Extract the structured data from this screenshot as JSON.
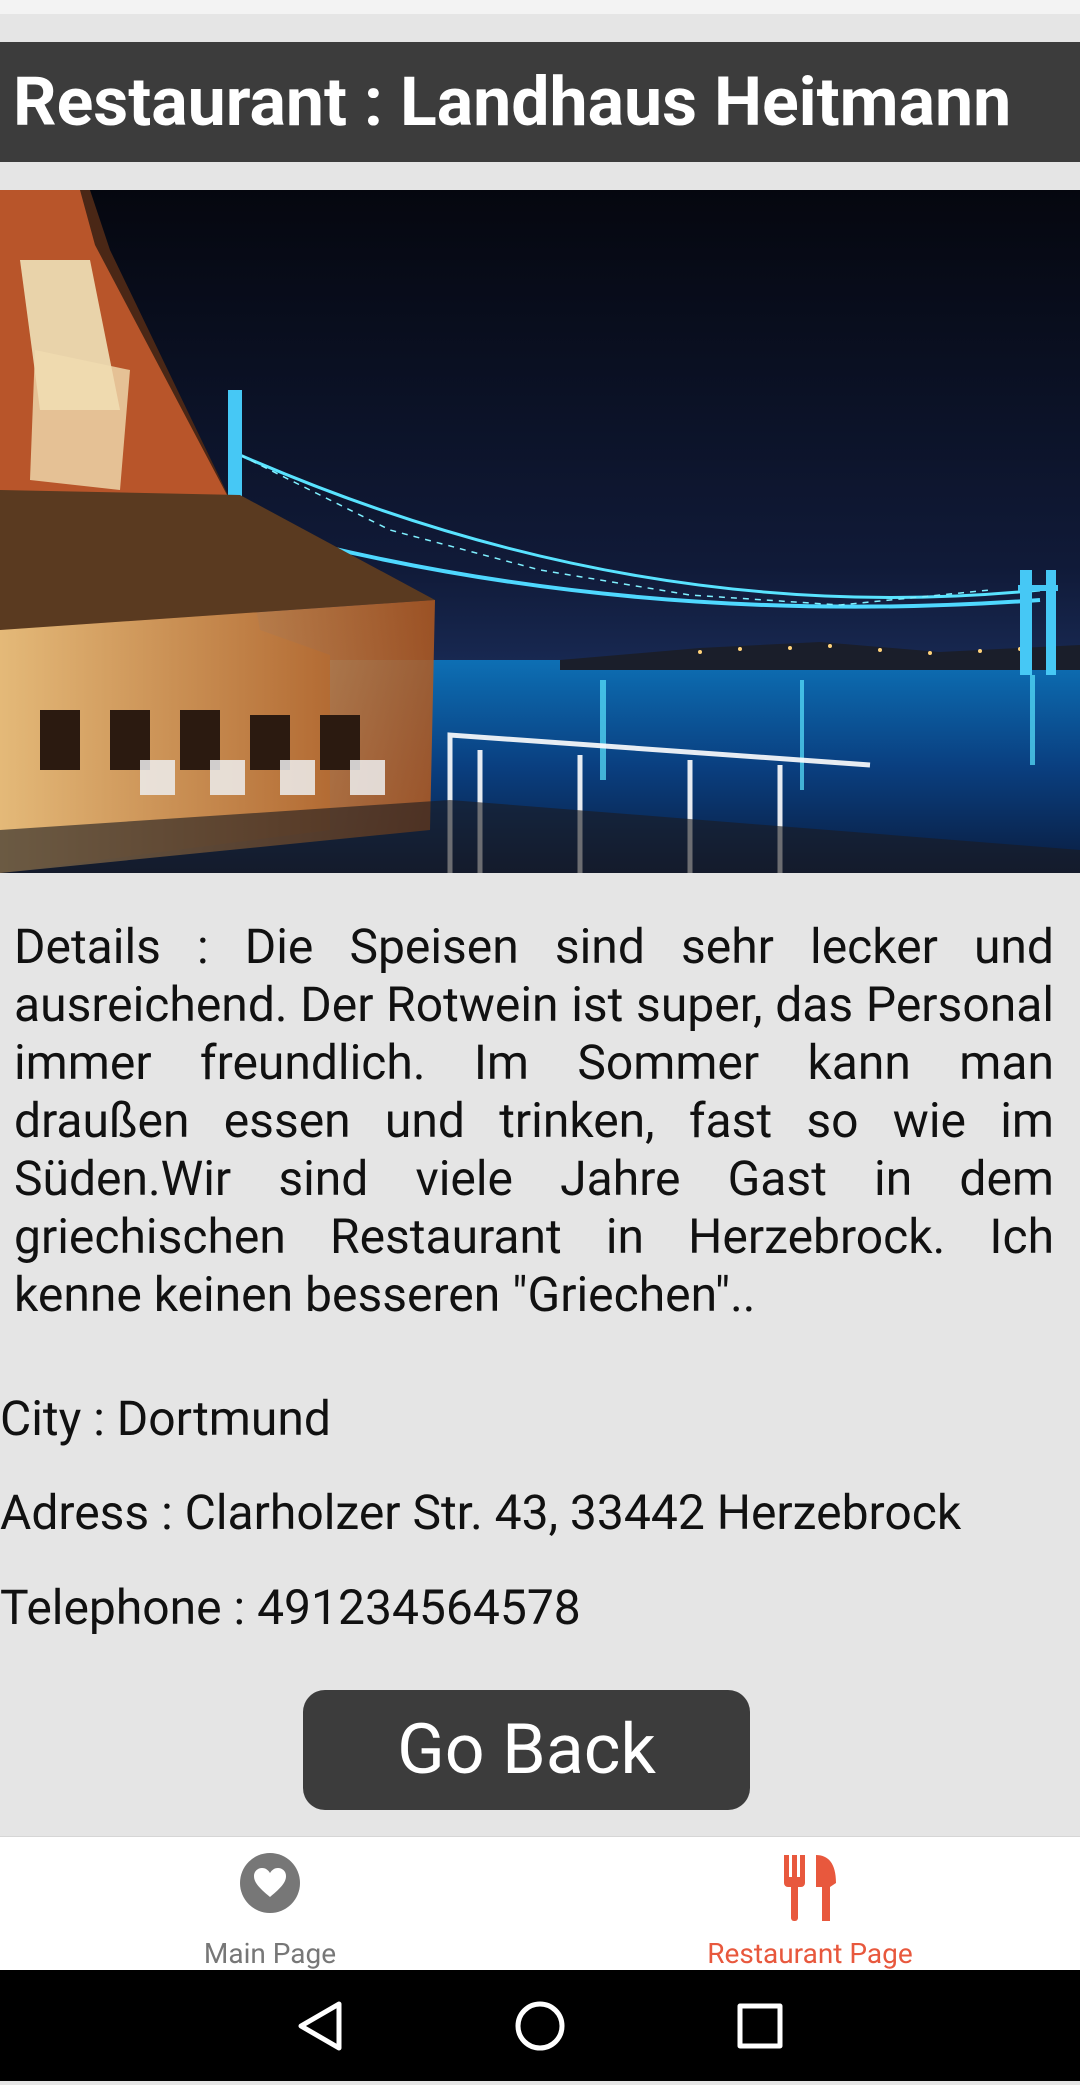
{
  "header": {
    "title": "Restaurant : Landhaus Heitmann"
  },
  "hero": {
    "description": "Night view of a waterfront restaurant terrace beside an illuminated suspension bridge"
  },
  "details": {
    "text": "Details : Die Speisen sind sehr lecker und ausreichend. Der Rotwein ist super, das Personal immer freundlich. Im Sommer kann man draußen essen und trinken, fast so wie im Süden.Wir sind viele Jahre Gast in dem griechischen Restaurant in Herzebrock. Ich kenne keinen besseren \"Griechen\".."
  },
  "info": {
    "city": "City :  Dortmund",
    "address": "Adress : Clarholzer Str. 43, 33442 Herzebrock",
    "telephone": "Telephone : 491234564578"
  },
  "actions": {
    "go_back_label": "Go Back"
  },
  "bottom_nav": {
    "items": [
      {
        "label": "Main Page",
        "icon": "heart-icon",
        "active": false
      },
      {
        "label": "Restaurant Page",
        "icon": "fork-knife-icon",
        "active": true
      }
    ]
  },
  "colors": {
    "header_bg": "#3c3c3c",
    "accent": "#e8583d",
    "inactive": "#777777",
    "page_bg": "#e5e5e5"
  },
  "system_nav": {
    "icons": [
      "back-triangle-icon",
      "home-circle-icon",
      "recents-square-icon"
    ]
  }
}
